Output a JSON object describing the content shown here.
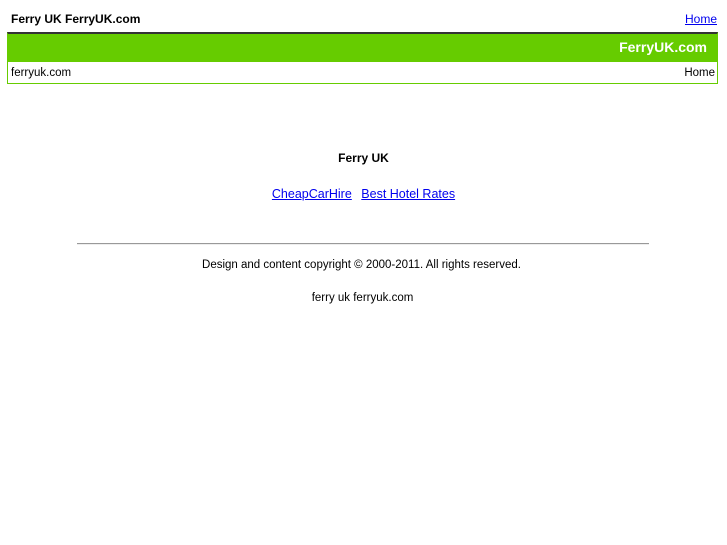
{
  "top_bar": {
    "site_heading": "Ferry UK FerryUK.com",
    "home_link": "Home"
  },
  "header": {
    "brand_title": "FerryUK.com",
    "domain_text": "ferryuk.com",
    "home_text": "Home",
    "accent_color": "#66cc00"
  },
  "main": {
    "title": "Ferry UK",
    "links": [
      "CheapCarHire",
      "Best Hotel Rates"
    ]
  },
  "footer": {
    "copyright": "Design and content copyright © 2000-2011. All rights reserved.",
    "keywords": "ferry uk ferryuk.com"
  }
}
